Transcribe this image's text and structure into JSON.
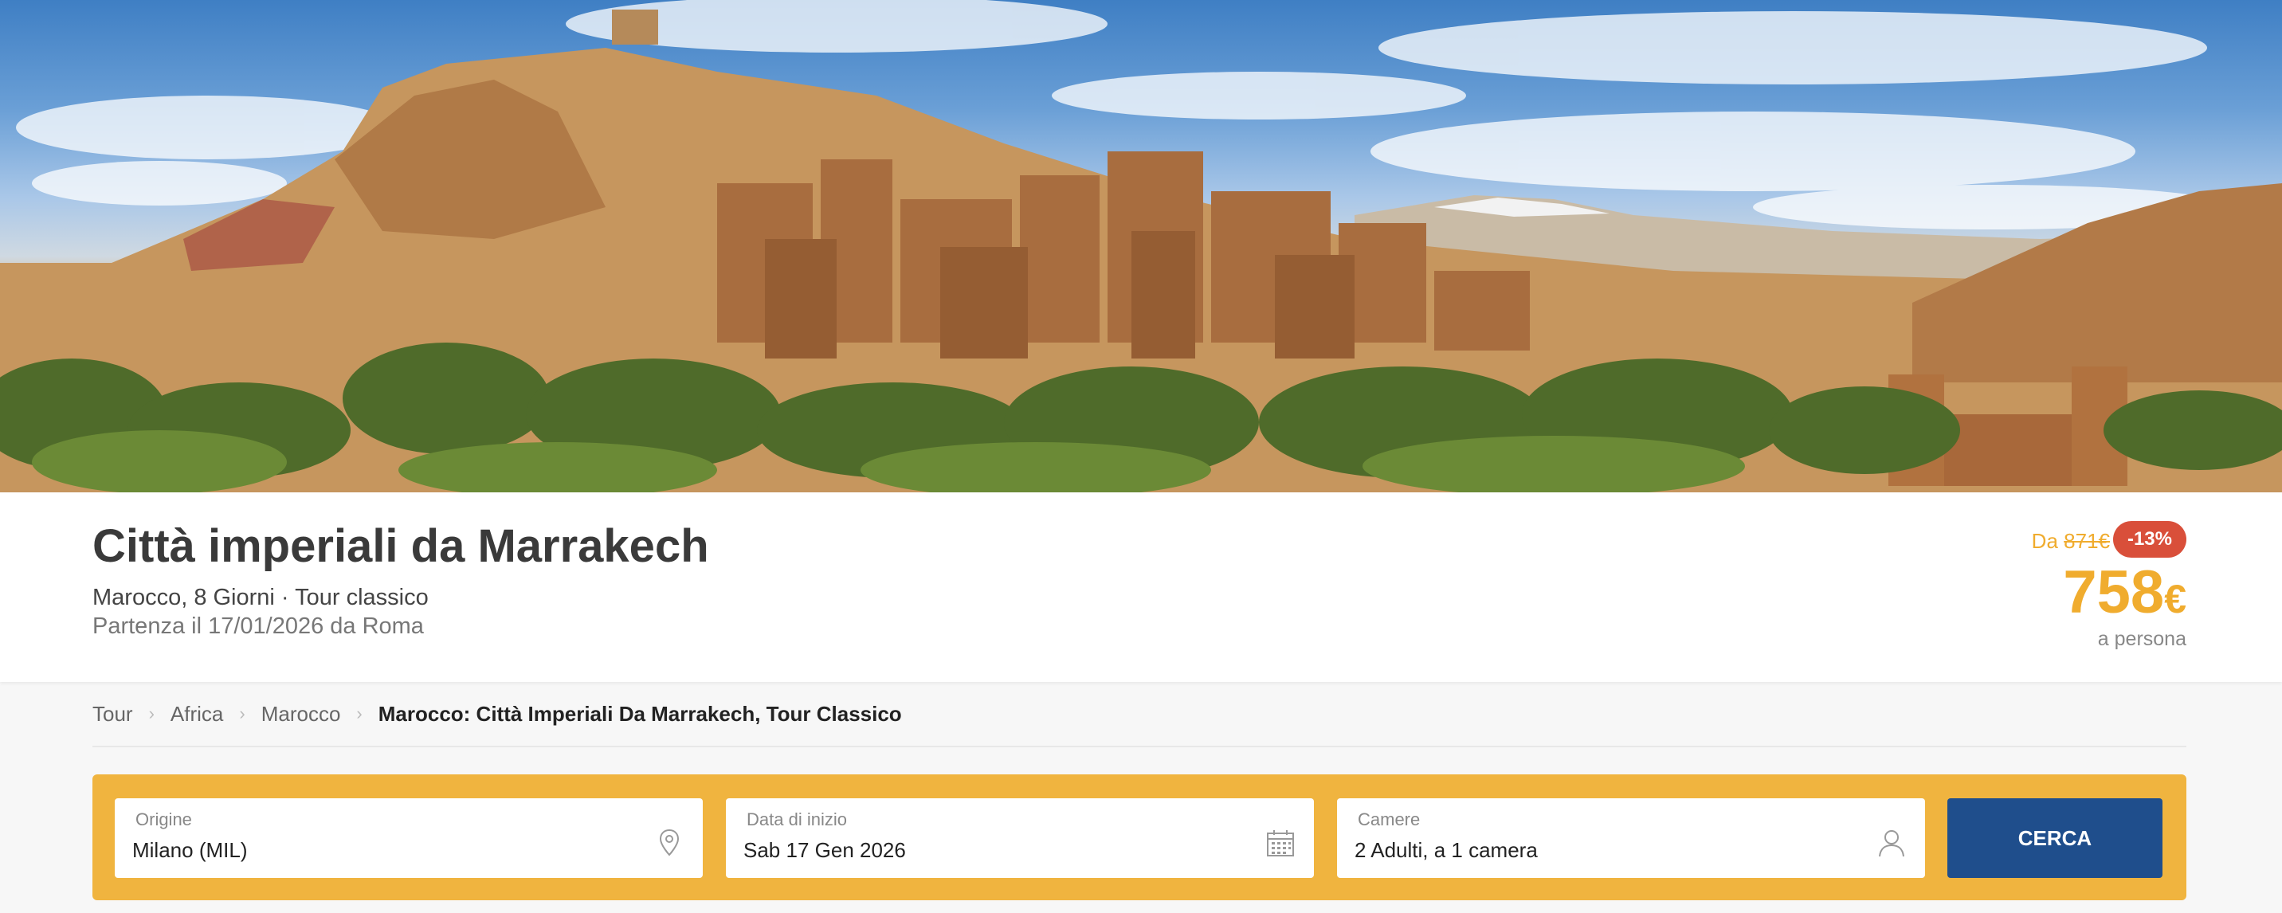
{
  "hero": {
    "alt": "Aït Benhaddou kasbah, Morocco"
  },
  "tour": {
    "title": "Città imperiali da Marrakech",
    "subtitle": "Marocco, 8 Giorni · Tour classico",
    "departure": "Partenza il 17/01/2026 da Roma"
  },
  "price": {
    "from_label": "Da",
    "old_price": "871€",
    "discount": "-13%",
    "amount": "758",
    "currency": "€",
    "per_person": "a persona",
    "accent_color": "#f0ac2e",
    "badge_color": "#d94f3a"
  },
  "breadcrumb": {
    "items": [
      "Tour",
      "Africa",
      "Marocco"
    ],
    "current": "Marocco: Città Imperiali Da Marrakech, Tour Classico"
  },
  "search": {
    "origin": {
      "label": "Origine",
      "value": "Milano (MIL)",
      "icon": "location-pin-icon"
    },
    "start_date": {
      "label": "Data di inizio",
      "value": "Sab 17 Gen 2026",
      "icon": "calendar-icon"
    },
    "rooms": {
      "label": "Camere",
      "value": "2 Adulti, a 1 camera",
      "icon": "user-icon"
    },
    "button_label": "CERCA",
    "bar_color": "#f0b43f",
    "button_color": "#1f4e8c"
  }
}
